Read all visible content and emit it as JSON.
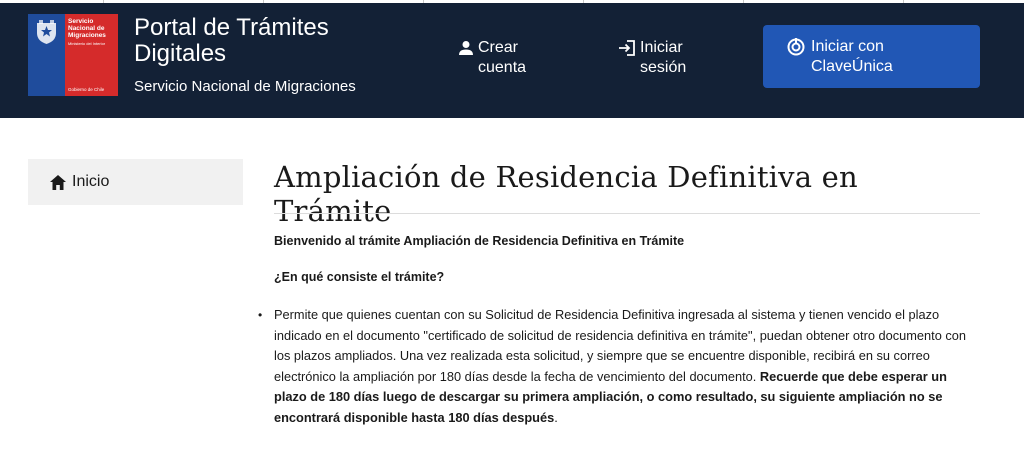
{
  "header": {
    "logo": {
      "line1": "Servicio",
      "line2": "Nacional de",
      "line3": "Migraciones",
      "ministry": "Ministerio del Interior",
      "government": "Gobierno de Chile"
    },
    "title": "Portal de Trámites Digitales",
    "subtitle": "Servicio Nacional de Migraciones",
    "nav": {
      "create_account": "Crear cuenta",
      "login": "Iniciar sesión",
      "clave_unica": "Iniciar con ClaveÚnica"
    },
    "colors": {
      "navbar_bg": "#132136",
      "primary_button": "#2157b5"
    }
  },
  "sidebar": {
    "items": [
      {
        "label": "Inicio",
        "icon": "home-icon"
      }
    ]
  },
  "main": {
    "title": "Ampliación de Residencia Definitiva en Trámite",
    "welcome": "Bienvenido al trámite Ampliación de Residencia Definitiva en Trámite",
    "question": "¿En qué consiste el trámite?",
    "description": "Permite que quienes cuentan con su Solicitud de Residencia Definitiva ingresada al sistema y tienen vencido el plazo indicado en el documento \"certificado de solicitud de residencia definitiva en trámite\", puedan obtener otro documento con los plazos ampliados. Una vez realizada esta solicitud, y siempre que se encuentre disponible, recibirá en su correo electrónico la ampliación por 180 días desde la fecha de vencimiento del documento. ",
    "description_bold": "Recuerde que debe esperar un plazo de 180 días luego de descargar su primera ampliación, o como resultado, su siguiente ampliación no se encontrará disponible hasta 180 días después",
    "description_end": "."
  }
}
